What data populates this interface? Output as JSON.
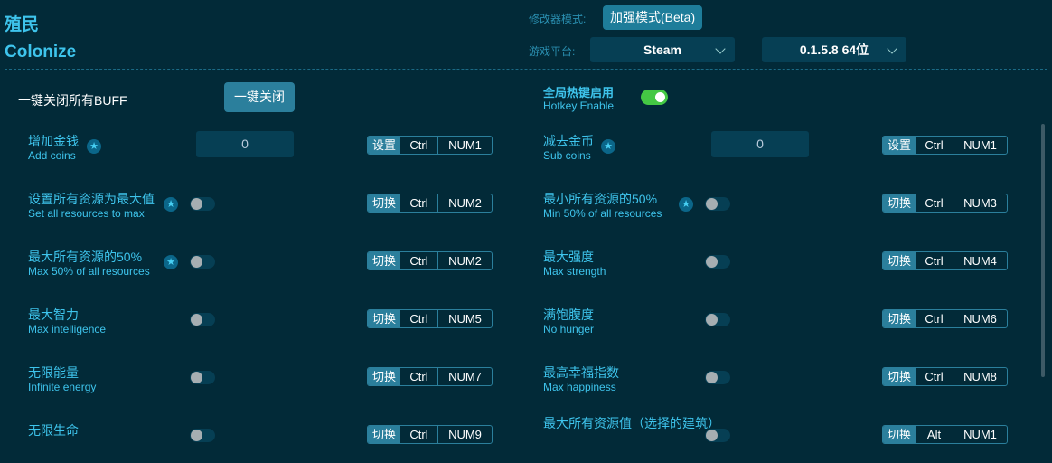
{
  "header": {
    "title_cn": "殖民",
    "title_en": "Colonize",
    "mode_label": "修改器模式:",
    "mode_button": "加强模式(Beta)",
    "platform_label": "游戏平台:",
    "platform_value": "Steam",
    "version_value": "0.1.5.8 64位"
  },
  "top": {
    "close_all_label": "一键关闭所有BUFF",
    "close_all_button": "一键关闭",
    "hotkey_cn": "全局热键启用",
    "hotkey_en": "Hotkey Enable",
    "hotkey_enabled": true
  },
  "left": [
    {
      "cn": "增加金钱",
      "en": "Add coins",
      "star": true,
      "input": "0",
      "k1": "设置",
      "k2": "Ctrl",
      "k3": "NUM1"
    },
    {
      "cn": "设置所有资源为最大值",
      "en": "Set all resources to max",
      "star": true,
      "k1": "切换",
      "k2": "Ctrl",
      "k3": "NUM2"
    },
    {
      "cn": "最大所有资源的50%",
      "en": "Max 50% of all resources",
      "star": true,
      "k1": "切换",
      "k2": "Ctrl",
      "k3": "NUM2"
    },
    {
      "cn": "最大智力",
      "en": "Max intelligence",
      "k1": "切换",
      "k2": "Ctrl",
      "k3": "NUM5"
    },
    {
      "cn": "无限能量",
      "en": "Infinite energy",
      "k1": "切换",
      "k2": "Ctrl",
      "k3": "NUM7"
    },
    {
      "cn": "无限生命",
      "en": "",
      "k1": "切换",
      "k2": "Ctrl",
      "k3": "NUM9"
    }
  ],
  "right": [
    {
      "cn": "减去金币",
      "en": "Sub coins",
      "star": true,
      "input": "0",
      "k1": "设置",
      "k2": "Ctrl",
      "k3": "NUM1"
    },
    {
      "cn": "最小所有资源的50%",
      "en": "Min 50% of all resources",
      "star": true,
      "k1": "切换",
      "k2": "Ctrl",
      "k3": "NUM3"
    },
    {
      "cn": "最大强度",
      "en": "Max strength",
      "k1": "切换",
      "k2": "Ctrl",
      "k3": "NUM4"
    },
    {
      "cn": "满饱腹度",
      "en": "No hunger",
      "k1": "切换",
      "k2": "Ctrl",
      "k3": "NUM6"
    },
    {
      "cn": "最高幸福指数",
      "en": "Max happiness",
      "k1": "切换",
      "k2": "Ctrl",
      "k3": "NUM8"
    },
    {
      "cn": "最大所有资源值（选择的建筑）",
      "en": "",
      "k1": "切换",
      "k2": "Alt",
      "k3": "NUM1"
    }
  ]
}
